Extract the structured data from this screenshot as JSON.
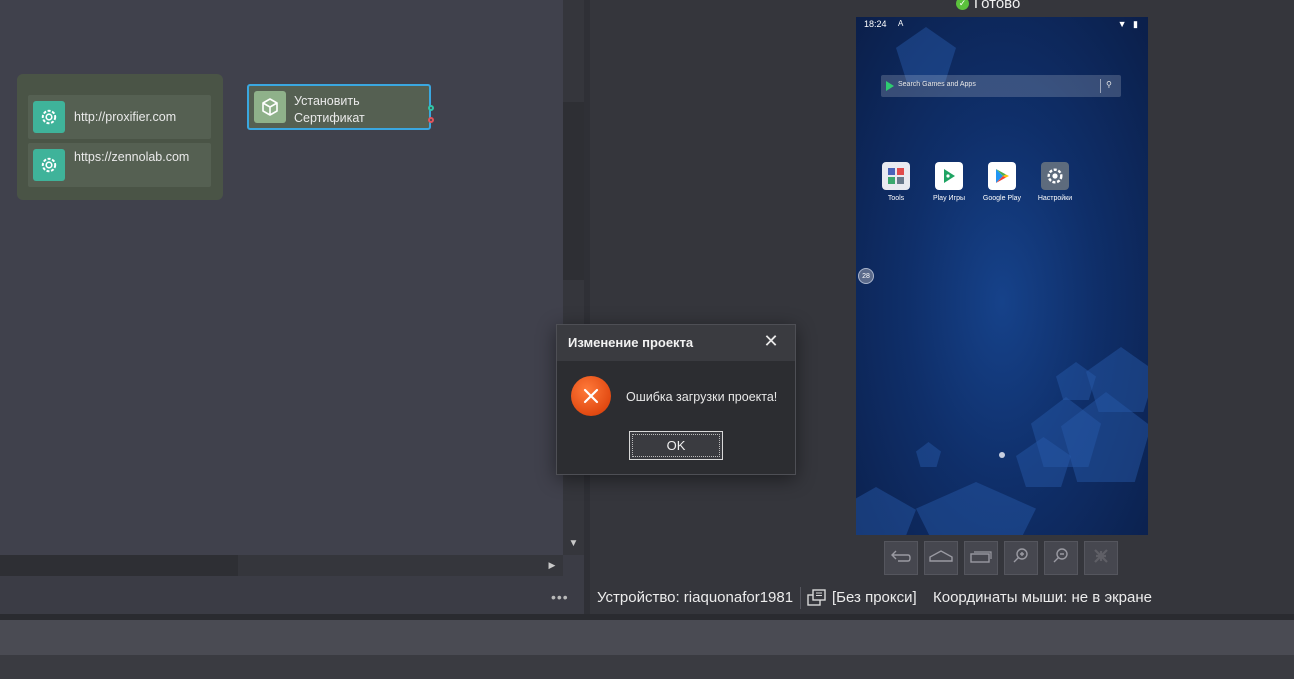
{
  "canvas": {
    "group": {
      "items": [
        {
          "label": "http://proxifier.com",
          "icon": "gear-icon"
        },
        {
          "label": "https://zennolab.com",
          "icon": "gear-icon"
        }
      ]
    },
    "node": {
      "label": "Установить Сертификат",
      "icon": "cube-icon"
    },
    "more_label": "•••"
  },
  "emulator": {
    "status": "Готово",
    "phone": {
      "time": "18:24",
      "notif": "A",
      "status_icons": "▼ ▮",
      "search_placeholder": "Search Games and Apps",
      "apps": [
        {
          "label": "Tools",
          "icon": "tools-folder-icon"
        },
        {
          "label": "Play Игры",
          "icon": "play-games-icon"
        },
        {
          "label": "Google Play",
          "icon": "google-play-icon"
        },
        {
          "label": "Настройки",
          "icon": "settings-icon"
        }
      ],
      "floating_badge": "28"
    },
    "controls": [
      "back",
      "home",
      "recent",
      "zoom-in",
      "zoom-out",
      "screenshot"
    ]
  },
  "statusbar": {
    "device": "Устройство: riaquonafor1981",
    "proxy": "[Без прокси]",
    "coords": "Координаты мыши: не в экране"
  },
  "dialog": {
    "title": "Изменение проекта",
    "close": "✕",
    "message": "Ошибка загрузки проекта!",
    "ok_label": "OK"
  },
  "colors": {
    "accent_blue": "#3aa7e0",
    "group_bg": "#4a5446",
    "action_icon_teal": "#3fb39a",
    "error_orange": "#e24a12",
    "status_green": "#5bc13c"
  }
}
